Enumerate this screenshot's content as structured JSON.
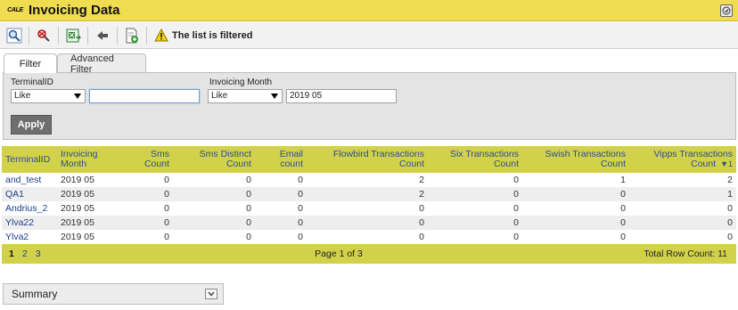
{
  "app": {
    "logo_text": "CALE",
    "title": "Invoicing Data"
  },
  "toolbar": {
    "buttons": [
      {
        "icon": "magnifier-icon"
      },
      {
        "icon": "clear-filter-icon"
      },
      {
        "icon": "export-excel-icon"
      },
      {
        "icon": "pin-icon"
      },
      {
        "icon": "add-document-icon"
      }
    ],
    "filter_message": "The list is filtered"
  },
  "tabs": [
    {
      "label": "Filter",
      "active": true
    },
    {
      "label": "Advanced Filter",
      "active": false
    }
  ],
  "filter": {
    "terminal_label": "TerminalID",
    "terminal_operator": "Like",
    "terminal_value": "",
    "month_label": "Invoicing Month",
    "month_operator": "Like",
    "month_value": "2019 05",
    "apply_label": "Apply"
  },
  "grid": {
    "columns": [
      "TerminalID",
      "Invoicing Month",
      "Sms Count",
      "Sms Distinct Count",
      "Email count",
      "Flowbird Transactions Count",
      "Six Transactions Count",
      "Swish Transactions Count",
      "Vipps Transactions Count"
    ],
    "sort_indicator": "▼1",
    "rows": [
      [
        "and_test",
        "2019 05",
        "0",
        "0",
        "0",
        "2",
        "0",
        "1",
        "2"
      ],
      [
        "QA1",
        "2019 05",
        "0",
        "0",
        "0",
        "2",
        "0",
        "0",
        "1"
      ],
      [
        "Andrius_2",
        "2019 05",
        "0",
        "0",
        "0",
        "0",
        "0",
        "0",
        "0"
      ],
      [
        "Ylva22",
        "2019 05",
        "0",
        "0",
        "0",
        "0",
        "0",
        "0",
        "0"
      ],
      [
        "Ylva2",
        "2019 05",
        "0",
        "0",
        "0",
        "0",
        "0",
        "0",
        "0"
      ]
    ]
  },
  "pager": {
    "pages": [
      "1",
      "2",
      "3"
    ],
    "current": "1",
    "page_info": "Page 1 of 3",
    "row_count": "Total Row Count: 11"
  },
  "summary": {
    "label": "Summary"
  }
}
